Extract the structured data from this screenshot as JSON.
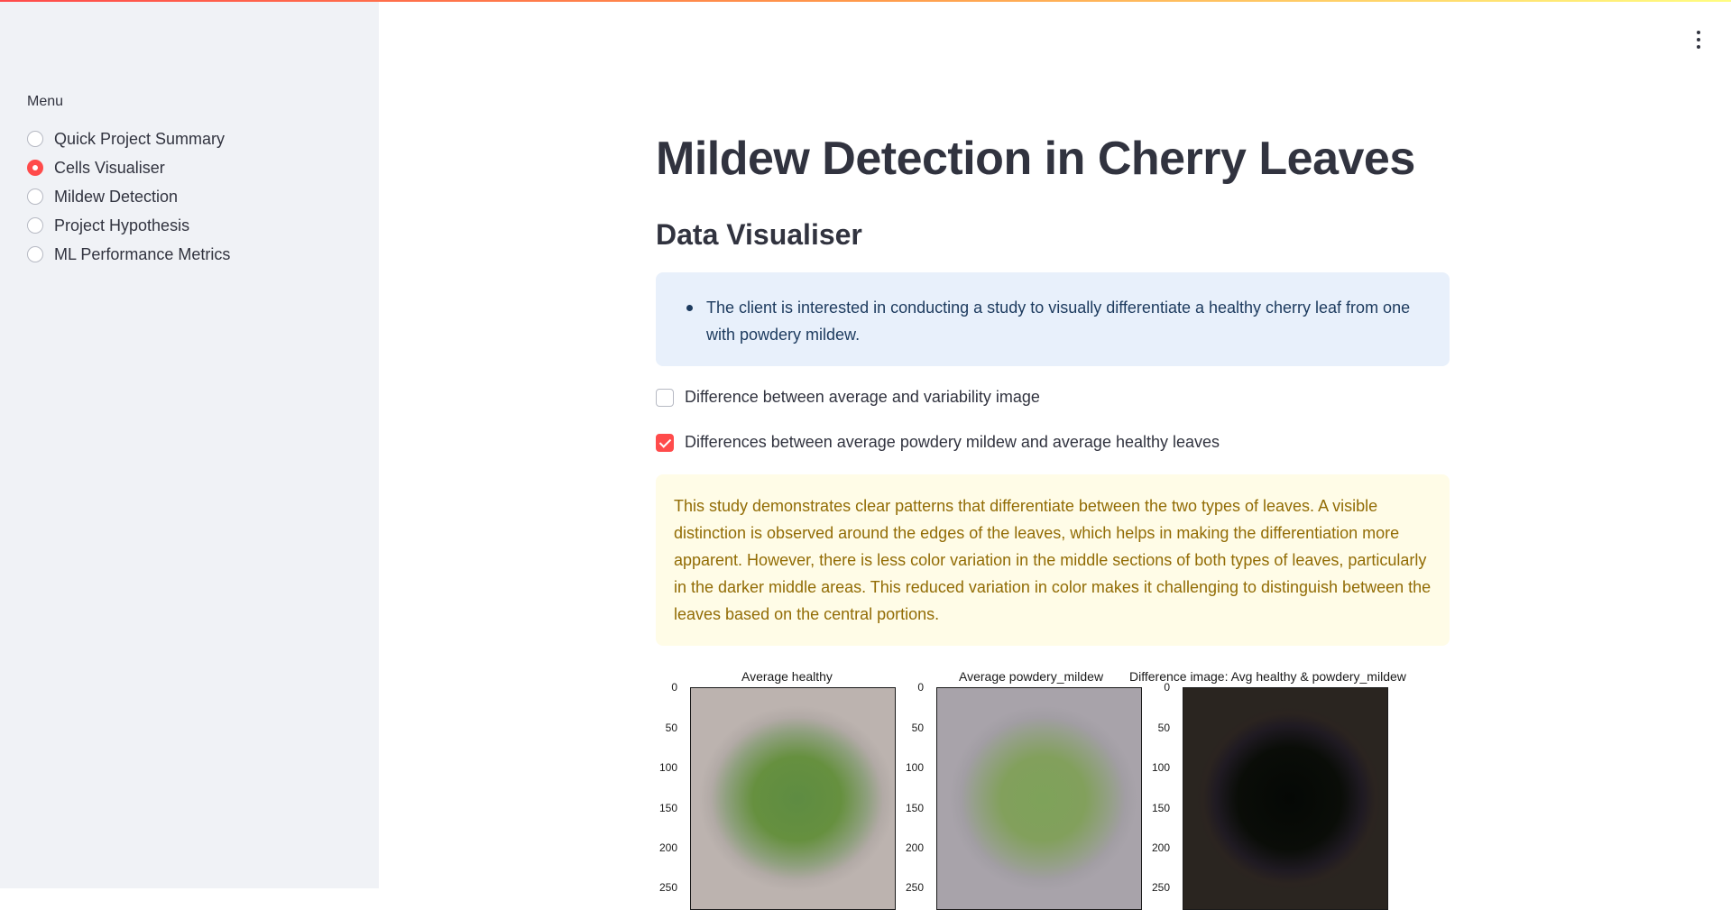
{
  "sidebar": {
    "menu_label": "Menu",
    "items": [
      {
        "label": "Quick Project Summary",
        "selected": false
      },
      {
        "label": "Cells Visualiser",
        "selected": true
      },
      {
        "label": "Mildew Detection",
        "selected": false
      },
      {
        "label": "Project Hypothesis",
        "selected": false
      },
      {
        "label": "ML Performance Metrics",
        "selected": false
      }
    ]
  },
  "header": {
    "menu_icon": "kebab-menu-icon"
  },
  "main": {
    "title": "Mildew Detection in Cherry Leaves",
    "subtitle": "Data Visualiser",
    "info_bullet": "The client is interested in conducting a study to visually differentiate a healthy cherry leaf from one with powdery mildew.",
    "checkboxes": [
      {
        "label": "Difference between average and variability image",
        "checked": false
      },
      {
        "label": "Differences between average powdery mildew and average healthy leaves",
        "checked": true
      }
    ],
    "warning_text": "This study demonstrates clear patterns that differentiate between the two types of leaves. A visible distinction is observed around the edges of the leaves, which helps in making the differentiation more apparent. However, there is less color variation in the middle sections of both types of leaves, particularly in the darker middle areas. This reduced variation in color makes it challenging to distinguish between the leaves based on the central portions.",
    "figure": {
      "panels": [
        {
          "title": "Average healthy"
        },
        {
          "title": "Average powdery_mildew"
        },
        {
          "title": "Difference image: Avg healthy & powdery_mildew"
        }
      ],
      "y_ticks": [
        "0",
        "50",
        "100",
        "150",
        "200",
        "250"
      ]
    }
  },
  "colors": {
    "accent": "#ff4b4b",
    "sidebar_bg": "#f0f2f6",
    "info_bg": "#e8f0fb",
    "info_text": "#1c3a5e",
    "warning_bg": "#fffce7",
    "warning_text": "#926c05"
  }
}
